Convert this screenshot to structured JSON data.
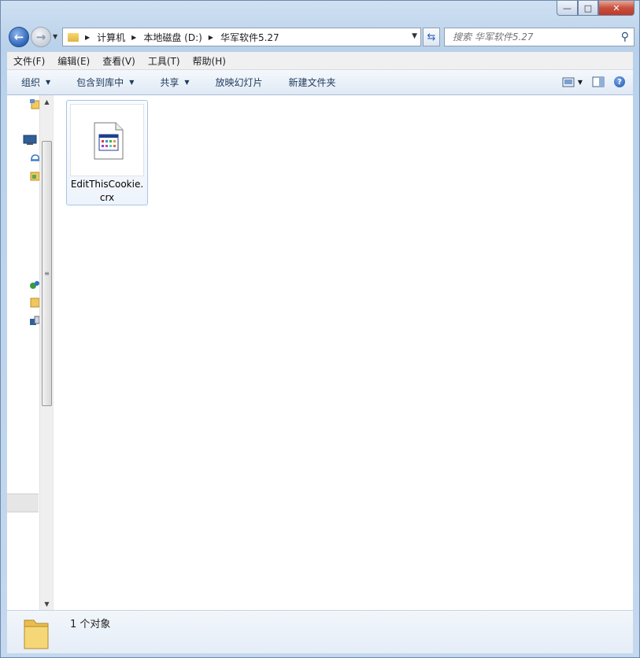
{
  "window": {
    "controls": {
      "minimize": "—",
      "maximize": "□",
      "close": "✕"
    }
  },
  "nav": {
    "back_icon": "back-arrow-icon",
    "forward_icon": "forward-arrow-icon",
    "breadcrumbs": [
      "计算机",
      "本地磁盘 (D:)",
      "华军软件5.27"
    ],
    "search_placeholder": "搜索 华军软件5.27"
  },
  "menu": {
    "items": [
      "文件(F)",
      "编辑(E)",
      "查看(V)",
      "工具(T)",
      "帮助(H)"
    ]
  },
  "toolbar": {
    "organize": "组织",
    "include_library": "包含到库中",
    "share": "共享",
    "slideshow": "放映幻灯片",
    "new_folder": "新建文件夹"
  },
  "files": [
    {
      "name_line1": "EditThisCookie.",
      "name_line2": "crx",
      "icon": "crx-file-icon"
    }
  ],
  "status": {
    "count_text": "1 个对象"
  },
  "colors": {
    "accent": "#2d64b8",
    "selection_border": "#a8c4e6"
  }
}
